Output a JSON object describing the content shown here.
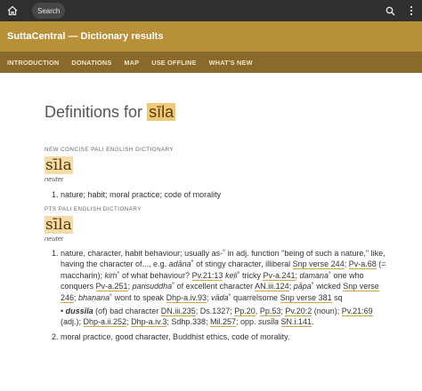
{
  "topbar": {
    "search_label": "Search",
    "icons": [
      "home-icon",
      "search-icon",
      "more-vertical-icon"
    ]
  },
  "site": {
    "title": "SuttaCentral — Dictionary results"
  },
  "nav": [
    "INTRODUCTION",
    "DONATIONS",
    "MAP",
    "USE OFFLINE",
    "WHAT'S NEW"
  ],
  "page": {
    "title_prefix": "Definitions for ",
    "term": "sīla"
  },
  "entries": [
    {
      "dict_name": "NEW CONCISE PALI ENGLISH DICTIONARY",
      "headword": "sīla",
      "grammar": "neuter",
      "definition": "nature; habit; moral practice; code of morality"
    },
    {
      "dict_name": "PTS PALI ENGLISH DICTIONARY",
      "headword": "sīla",
      "grammar": "neuter",
      "def1": {
        "l1": "nature, character, habit behaviour; usually as-˚ in adj. function \"being of such a nature,\"",
        "l2a": "like, having the character of..., e.g. ",
        "adana": "adāna",
        "l2b": "˚ of stingy character, illiberal ",
        "ref_snp244": "Snp verse 244",
        "l2c": ";",
        "ref_pv68": "Pv-a.68",
        "l3a": " (= maccharin); ",
        "kim": "kiṁ",
        "l3b": "˚ of what behaviour? ",
        "ref_pv2113": "Pv.21:13",
        "keli": "keḷi",
        "l3c": "˚ tricky ",
        "ref_pva241": "Pv-a.241",
        "l3d": ";",
        "damana": "damana",
        "l4a": "˚ one who conquers ",
        "ref_pva251": "Pv-a.251",
        "l4b": "; ",
        "parisuddha": "parisuddha",
        "l4c": "˚ of excellent character ",
        "ref_an3124": "AN.iii.124",
        "l4d": ";",
        "papa": "pāpa",
        "l5a": "˚ wicked ",
        "ref_snp246": "Snp verse 246",
        "l5b": "; ",
        "bhanana": "bhaṇana",
        "l5c": "˚ wont to speak ",
        "ref_dhpa93": "Dhp-a.iv.93",
        "l5d": "; ",
        "vada": "vāda",
        "l5e": "˚ quarrelsome",
        "ref_snp381": "Snp verse 381",
        "l6a": " sq",
        "dussila": "dussīla",
        "l7a": " (of) bad character ",
        "ref_dn235": "DN.iii.235",
        "l7b": "; Ds.1327; ",
        "ref_pp20": "Pp.20",
        "l7c": ", ",
        "ref_pp53": "Pp.53",
        "l7d": "; ",
        "ref_pv202": "Pv.20:2",
        "l7e": " (noun); ",
        "ref_pv2169": "Pv.21:69",
        "l8a": "(adj.); ",
        "ref_dhpa252": "Dhp-a.ii.252",
        "l8b": "; ",
        "ref_dhpa3": "Dhp-a.iv.3",
        "l8c": "; Sdhp.338; ",
        "ref_mil257": "Mil.257",
        "l8d": "; opp. ",
        "susila": "susīla",
        "l8e": " ",
        "ref_sn141": "SN.i.141",
        "l8f": "."
      },
      "def2": "moral practice, good character, Buddhist ethics, code of morality."
    }
  ],
  "colors": {
    "topbar": "#2f2f2f",
    "titlebar": "#b8903a",
    "navbar": "#8a6a2a",
    "highlight": "#f3dca9",
    "link_underline": "#d4a24a"
  }
}
